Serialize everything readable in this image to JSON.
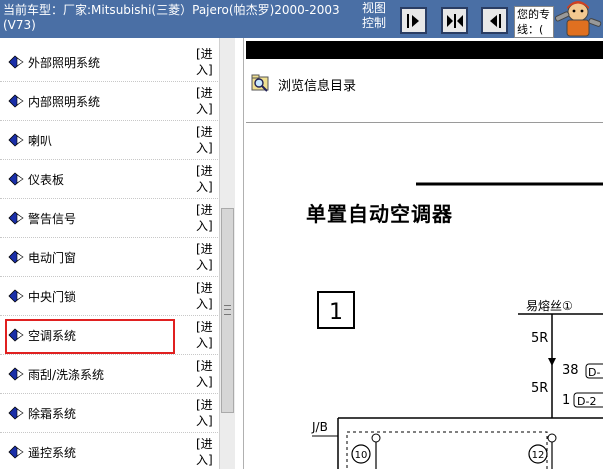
{
  "header": {
    "car_line1": "当前车型：厂家:Mitsubishi(三菱）Pajero(帕杰罗)2000-2003",
    "car_line2": "(V73)",
    "view_label": "视图控制",
    "message": "您的专线：(",
    "buttons": [
      "next-page",
      "expand-view",
      "previous-page"
    ]
  },
  "menu": {
    "enter_label": "[进入]",
    "items": [
      {
        "label": "外部照明系统"
      },
      {
        "label": "内部照明系统"
      },
      {
        "label": "喇叭"
      },
      {
        "label": "仪表板"
      },
      {
        "label": "警告信号"
      },
      {
        "label": "电动门窗"
      },
      {
        "label": "中央门锁"
      },
      {
        "label": "空调系统",
        "highlighted": true
      },
      {
        "label": "雨刮/洗涤系统"
      },
      {
        "label": "除霜系统"
      },
      {
        "label": "遥控系统"
      }
    ]
  },
  "document": {
    "browse_label": "浏览信息目录",
    "title": "单置自动空调器",
    "figure_number": "1",
    "fuse_label": "易熔丝①",
    "wire_top": "5R",
    "pin_38": "38",
    "wire_mid": "5R",
    "pin_1": "1",
    "tag_a": "D-",
    "tag_b": "D-2",
    "jb_label": "J/B",
    "circle_10": "10",
    "circle_12": "12"
  },
  "colors": {
    "topbar": "#4a6fa5",
    "highlight": "#e02020",
    "menu_icon": "#1a2fa8"
  }
}
